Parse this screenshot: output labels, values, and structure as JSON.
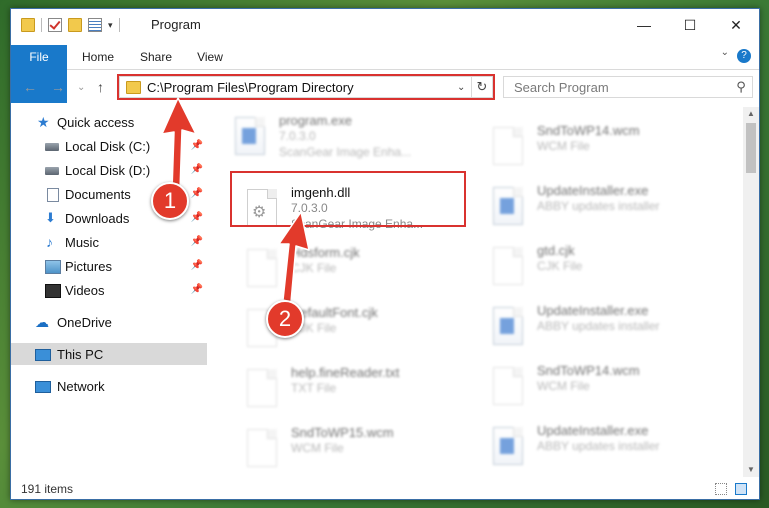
{
  "window": {
    "title": "Program",
    "minimize_icon": "minimize-icon",
    "maximize_icon": "maximize-icon",
    "close_icon": "close-icon"
  },
  "ribbon": {
    "tabs": [
      {
        "label": "File"
      },
      {
        "label": "Home"
      },
      {
        "label": "Share"
      },
      {
        "label": "View"
      }
    ]
  },
  "address": {
    "path": "C:\\Program Files\\Program Directory"
  },
  "search": {
    "placeholder": "Search Program"
  },
  "nav": {
    "items": [
      {
        "label": "Quick access"
      },
      {
        "label": "Local Disk (C:)"
      },
      {
        "label": "Local Disk (D:)"
      },
      {
        "label": "Documents"
      },
      {
        "label": "Downloads"
      },
      {
        "label": "Music"
      },
      {
        "label": "Pictures"
      },
      {
        "label": "Videos"
      },
      {
        "label": "OneDrive"
      },
      {
        "label": "This PC"
      },
      {
        "label": "Network"
      }
    ]
  },
  "files": {
    "left": [
      {
        "name": "program.exe",
        "line2": "7.0.3.0",
        "line3": "ScanGear Image Enha..."
      },
      {
        "name": "imgenh.dll",
        "line2": "7.0.3.0",
        "line3": "ScanGear Image Enha..."
      },
      {
        "name": "Hdsform.cjk",
        "line2": "CJK File"
      },
      {
        "name": "DefaultFont.cjk",
        "line2": "CJK File"
      },
      {
        "name": "help.fineReader.txt",
        "line2": "TXT File"
      },
      {
        "name": "SndToWP15.wcm",
        "line2": "WCM File"
      }
    ],
    "right": [
      {
        "name": "SndToWP14.wcm",
        "line2": "WCM File"
      },
      {
        "name": "UpdateInstaller.exe",
        "line2": "ABBY updates installer"
      },
      {
        "name": "gtd.cjk",
        "line2": "CJK File"
      },
      {
        "name": "UpdateInstaller.exe",
        "line2": "ABBY updates installer"
      },
      {
        "name": "SndToWP14.wcm",
        "line2": "WCM File"
      },
      {
        "name": "UpdateInstaller.exe",
        "line2": "ABBY updates installer"
      }
    ]
  },
  "status": {
    "count": "191 items"
  },
  "annotations": {
    "step1": "1",
    "step2": "2",
    "color": "#e23a2b"
  }
}
